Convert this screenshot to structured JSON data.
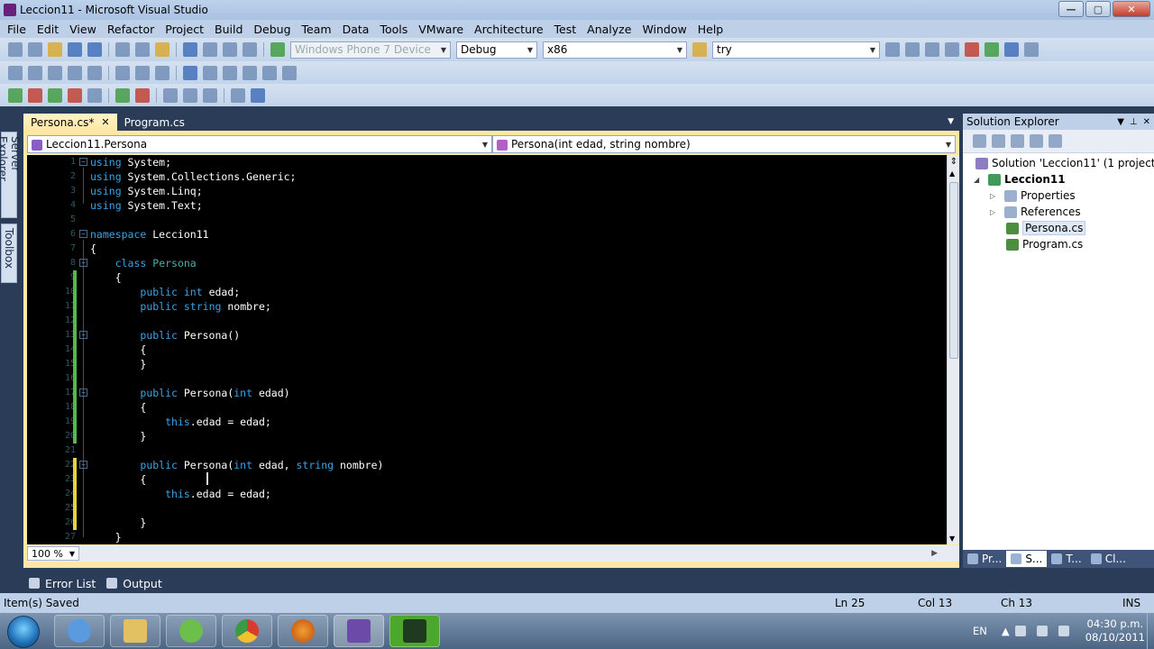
{
  "window": {
    "title": "Leccion11 - Microsoft Visual Studio",
    "min": "—",
    "max": "▢",
    "close": "✕"
  },
  "menu": [
    "File",
    "Edit",
    "View",
    "Refactor",
    "Project",
    "Build",
    "Debug",
    "Team",
    "Data",
    "Tools",
    "VMware",
    "Architecture",
    "Test",
    "Analyze",
    "Window",
    "Help"
  ],
  "toolbar": {
    "device": "Windows Phone 7 Device",
    "config": "Debug",
    "platform": "x86",
    "find": "try"
  },
  "side_tabs": {
    "server_explorer": "Server Explorer",
    "toolbox": "Toolbox"
  },
  "doc_tabs": [
    {
      "label": "Persona.cs*",
      "active": true,
      "close": "✕"
    },
    {
      "label": "Program.cs",
      "active": false
    }
  ],
  "nav": {
    "type": "Leccion11.Persona",
    "member": "Persona(int edad, string nombre)"
  },
  "code": {
    "line_numbers": [
      "1",
      "2",
      "3",
      "4",
      "5",
      "6",
      "7",
      "8",
      "9",
      "10",
      "11",
      "12",
      "13",
      "14",
      "15",
      "16",
      "17",
      "18",
      "19",
      "20",
      "21",
      "22",
      "23",
      "24",
      "25",
      "26",
      "27"
    ],
    "lines": [
      [
        {
          "t": "using",
          "c": "kw"
        },
        {
          "t": " System;"
        }
      ],
      [
        {
          "t": "using",
          "c": "kw"
        },
        {
          "t": " System.Collections.Generic;"
        }
      ],
      [
        {
          "t": "using",
          "c": "kw"
        },
        {
          "t": " System.Linq;"
        }
      ],
      [
        {
          "t": "using",
          "c": "kw"
        },
        {
          "t": " System.Text;"
        }
      ],
      [],
      [
        {
          "t": "namespace",
          "c": "kw"
        },
        {
          "t": " Leccion11"
        }
      ],
      [
        {
          "t": "{"
        }
      ],
      [
        {
          "t": "    "
        },
        {
          "t": "class",
          "c": "kw"
        },
        {
          "t": " "
        },
        {
          "t": "Persona",
          "c": "cls"
        }
      ],
      [
        {
          "t": "    {"
        }
      ],
      [
        {
          "t": "        "
        },
        {
          "t": "public",
          "c": "kw"
        },
        {
          "t": " "
        },
        {
          "t": "int",
          "c": "kw"
        },
        {
          "t": " edad;"
        }
      ],
      [
        {
          "t": "        "
        },
        {
          "t": "public",
          "c": "kw"
        },
        {
          "t": " "
        },
        {
          "t": "string",
          "c": "kw"
        },
        {
          "t": " nombre;"
        }
      ],
      [],
      [
        {
          "t": "        "
        },
        {
          "t": "public",
          "c": "kw"
        },
        {
          "t": " Persona()"
        }
      ],
      [
        {
          "t": "        {"
        }
      ],
      [
        {
          "t": "        }"
        }
      ],
      [],
      [
        {
          "t": "        "
        },
        {
          "t": "public",
          "c": "kw"
        },
        {
          "t": " Persona("
        },
        {
          "t": "int",
          "c": "kw"
        },
        {
          "t": " edad)"
        }
      ],
      [
        {
          "t": "        {"
        }
      ],
      [
        {
          "t": "            "
        },
        {
          "t": "this",
          "c": "kw"
        },
        {
          "t": ".edad = edad;"
        }
      ],
      [
        {
          "t": "        }"
        }
      ],
      [],
      [
        {
          "t": "        "
        },
        {
          "t": "public",
          "c": "kw"
        },
        {
          "t": " Persona("
        },
        {
          "t": "int",
          "c": "kw"
        },
        {
          "t": " edad, "
        },
        {
          "t": "string",
          "c": "kw"
        },
        {
          "t": " nombre)"
        }
      ],
      [
        {
          "t": "        {"
        }
      ],
      [
        {
          "t": "            "
        },
        {
          "t": "this",
          "c": "kw"
        },
        {
          "t": ".edad = edad;"
        }
      ],
      [],
      [
        {
          "t": "        }"
        }
      ],
      [
        {
          "t": "    }"
        }
      ]
    ]
  },
  "zoom": "100 %",
  "solution_explorer": {
    "title": "Solution Explorer",
    "nodes": [
      {
        "label": "Solution 'Leccion11' (1 project)",
        "icon": "solution-icon"
      },
      {
        "label": "Leccion11",
        "icon": "project-icon",
        "bold": true
      },
      {
        "label": "Properties",
        "icon": "properties-folder-icon"
      },
      {
        "label": "References",
        "icon": "references-folder-icon"
      },
      {
        "label": "Persona.cs",
        "icon": "csharp-file-icon",
        "selected": true
      },
      {
        "label": "Program.cs",
        "icon": "csharp-file-icon"
      }
    ],
    "bottom_tabs": [
      "Pr...",
      "S...",
      "T...",
      "Cl..."
    ]
  },
  "bottom_tabs": [
    "Error List",
    "Output"
  ],
  "status": {
    "message": "Item(s) Saved",
    "ln": "Ln 25",
    "col": "Col 13",
    "ch": "Ch 13",
    "mode": "INS"
  },
  "taskbar": {
    "lang": "EN",
    "time": "04:30 p.m.",
    "date": "08/10/2011"
  },
  "colors": {
    "editor_bg": "#000000",
    "keyword": "#3ba3e6",
    "class_name": "#4cb0a8",
    "doc_tab_active": "#ffe8a6",
    "ide_frame": "#2b3c59"
  }
}
